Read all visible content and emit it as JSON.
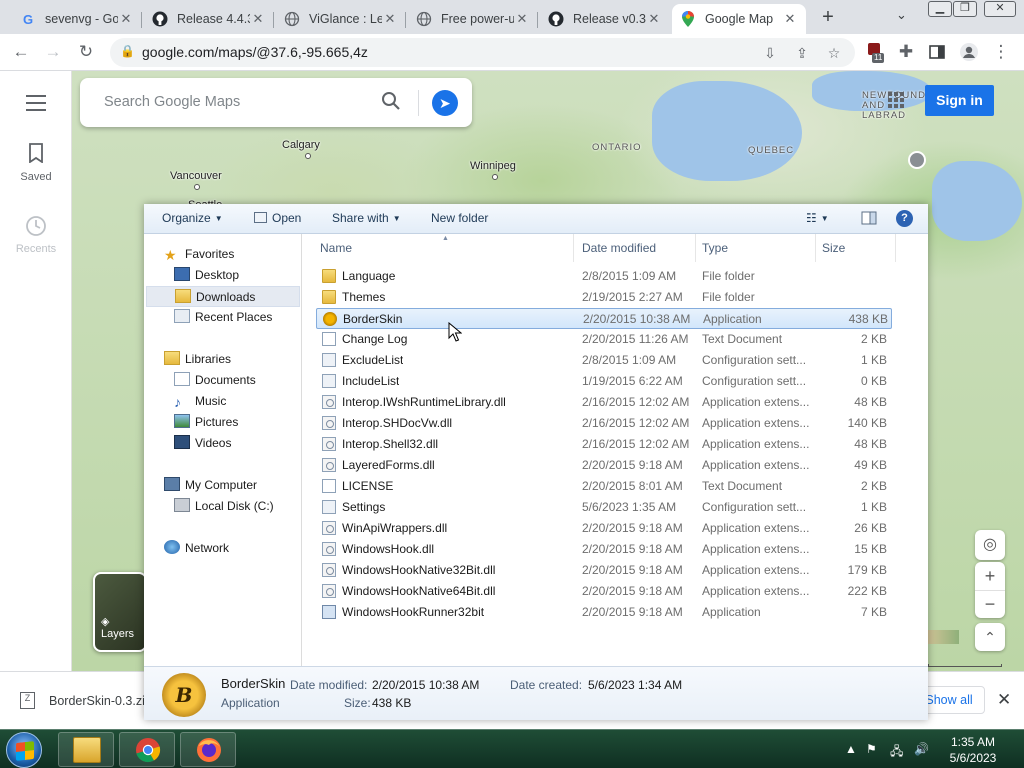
{
  "browser": {
    "tabs": [
      {
        "title": "sevenvg - Go",
        "favicon": "google-icon"
      },
      {
        "title": "Release 4.4.3",
        "favicon": "github-icon"
      },
      {
        "title": "ViGlance : Le",
        "favicon": "globe-icon"
      },
      {
        "title": "Free power-u",
        "favicon": "globe-icon"
      },
      {
        "title": "Release v0.3",
        "favicon": "github-icon"
      },
      {
        "title": "Google Map",
        "favicon": "maps-pin-icon",
        "active": true
      }
    ],
    "url": "google.com/maps/@37.6,-95.665,4z",
    "extension_badge": "11"
  },
  "maps": {
    "search_placeholder": "Search Google Maps",
    "sign_in": "Sign in",
    "sidebar": [
      {
        "label": "Saved",
        "icon": "bookmark-icon"
      },
      {
        "label": "Recents",
        "icon": "history-icon"
      }
    ],
    "layers_label": "Layers",
    "places": [
      "Calgary",
      "Winnipeg",
      "Vancouver",
      "Seattle"
    ],
    "regions": [
      "ONTARIO",
      "QUEBEC",
      "NEWFOUNDL AND LABRAD"
    ]
  },
  "explorer": {
    "toolbar": {
      "organize": "Organize",
      "open": "Open",
      "share_with": "Share with",
      "new_folder": "New folder"
    },
    "nav": {
      "favorites": "Favorites",
      "desktop": "Desktop",
      "downloads": "Downloads",
      "recent_places": "Recent Places",
      "libraries": "Libraries",
      "documents": "Documents",
      "music": "Music",
      "pictures": "Pictures",
      "videos": "Videos",
      "my_computer": "My Computer",
      "local_disk": "Local Disk (C:)",
      "network": "Network"
    },
    "columns": {
      "name": "Name",
      "date": "Date modified",
      "type": "Type",
      "size": "Size"
    },
    "files": [
      {
        "name": "Language",
        "date": "2/8/2015 1:09 AM",
        "type": "File folder",
        "size": "",
        "icon": "folder"
      },
      {
        "name": "Themes",
        "date": "2/19/2015 2:27 AM",
        "type": "File folder",
        "size": "",
        "icon": "folder"
      },
      {
        "name": "BorderSkin",
        "date": "2/20/2015 10:38 AM",
        "type": "Application",
        "size": "438 KB",
        "icon": "bs"
      },
      {
        "name": "Change Log",
        "date": "2/20/2015 11:26 AM",
        "type": "Text Document",
        "size": "2 KB",
        "icon": "doc"
      },
      {
        "name": "ExcludeList",
        "date": "2/8/2015 1:09 AM",
        "type": "Configuration sett...",
        "size": "1 KB",
        "icon": "cfg"
      },
      {
        "name": "IncludeList",
        "date": "1/19/2015 6:22 AM",
        "type": "Configuration sett...",
        "size": "0 KB",
        "icon": "cfg"
      },
      {
        "name": "Interop.IWshRuntimeLibrary.dll",
        "date": "2/16/2015 12:02 AM",
        "type": "Application extens...",
        "size": "48 KB",
        "icon": "dll"
      },
      {
        "name": "Interop.SHDocVw.dll",
        "date": "2/16/2015 12:02 AM",
        "type": "Application extens...",
        "size": "140 KB",
        "icon": "dll"
      },
      {
        "name": "Interop.Shell32.dll",
        "date": "2/16/2015 12:02 AM",
        "type": "Application extens...",
        "size": "48 KB",
        "icon": "dll"
      },
      {
        "name": "LayeredForms.dll",
        "date": "2/20/2015 9:18 AM",
        "type": "Application extens...",
        "size": "49 KB",
        "icon": "dll"
      },
      {
        "name": "LICENSE",
        "date": "2/20/2015 8:01 AM",
        "type": "Text Document",
        "size": "2 KB",
        "icon": "doc"
      },
      {
        "name": "Settings",
        "date": "5/6/2023 1:35 AM",
        "type": "Configuration sett...",
        "size": "1 KB",
        "icon": "cfg"
      },
      {
        "name": "WinApiWrappers.dll",
        "date": "2/20/2015 9:18 AM",
        "type": "Application extens...",
        "size": "26 KB",
        "icon": "dll"
      },
      {
        "name": "WindowsHook.dll",
        "date": "2/20/2015 9:18 AM",
        "type": "Application extens...",
        "size": "15 KB",
        "icon": "dll"
      },
      {
        "name": "WindowsHookNative32Bit.dll",
        "date": "2/20/2015 9:18 AM",
        "type": "Application extens...",
        "size": "179 KB",
        "icon": "dll"
      },
      {
        "name": "WindowsHookNative64Bit.dll",
        "date": "2/20/2015 9:18 AM",
        "type": "Application extens...",
        "size": "222 KB",
        "icon": "dll"
      },
      {
        "name": "WindowsHookRunner32bit",
        "date": "2/20/2015 9:18 AM",
        "type": "Application",
        "size": "7 KB",
        "icon": "app"
      }
    ],
    "selected_index": 2,
    "details": {
      "name": "BorderSkin",
      "type": "Application",
      "modified_label": "Date modified:",
      "modified": "2/20/2015 10:38 AM",
      "created_label": "Date created:",
      "created": "5/6/2023 1:34 AM",
      "size_label": "Size:",
      "size": "438 KB",
      "icon_text": "B"
    }
  },
  "downloads_bar": {
    "file": "BorderSkin-0.3.zi",
    "show_all": "Show all"
  },
  "taskbar": {
    "time": "1:35 AM",
    "date": "5/6/2023"
  }
}
